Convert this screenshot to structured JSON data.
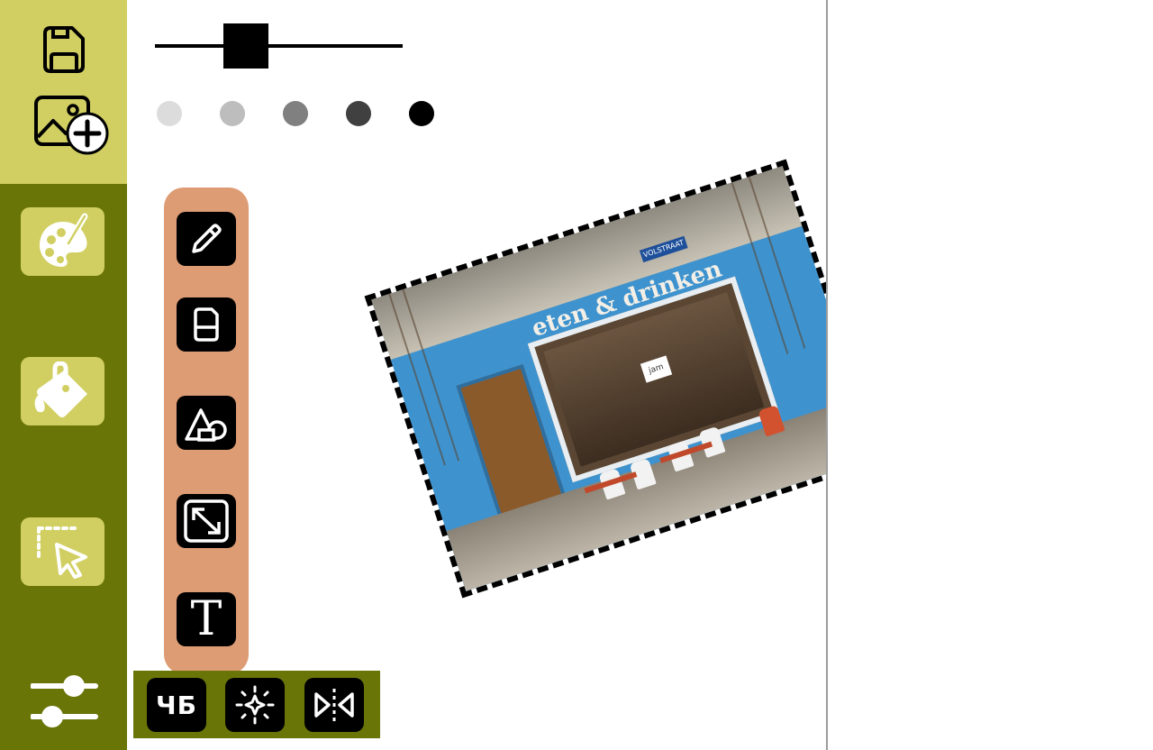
{
  "sidebar": {
    "top_buttons": [
      {
        "name": "save",
        "icon": "save-icon"
      },
      {
        "name": "add-image",
        "icon": "add-image-icon"
      }
    ],
    "main_buttons": [
      {
        "name": "palette",
        "icon": "palette-icon"
      },
      {
        "name": "fill",
        "icon": "paint-bucket-icon"
      },
      {
        "name": "select",
        "icon": "selection-pointer-icon"
      }
    ],
    "bottom_icon": "sliders-icon"
  },
  "brush": {
    "size_level": 0.36,
    "colors": [
      "#dcdcdc",
      "#bdbdbd",
      "#808080",
      "#404040",
      "#000000"
    ]
  },
  "tools": [
    {
      "name": "pencil",
      "icon": "pencil-icon"
    },
    {
      "name": "eraser",
      "icon": "eraser-icon"
    },
    {
      "name": "shapes",
      "icon": "shapes-icon"
    },
    {
      "name": "resize",
      "icon": "resize-icon"
    },
    {
      "name": "text",
      "icon": "text-icon",
      "glyph": "T"
    }
  ],
  "filters": {
    "bw_label": "ЧБ",
    "items": [
      {
        "name": "black-white",
        "icon": "bw-filter-icon"
      },
      {
        "name": "brightness",
        "icon": "brightness-sparkle-icon"
      },
      {
        "name": "mirror",
        "icon": "mirror-flip-icon"
      }
    ]
  },
  "photo": {
    "sign_text": "eten & drinken",
    "street_plate": "VOLSTRAAT",
    "window_logo": "jam"
  },
  "colors": {
    "sidebar_light": "#d1cf62",
    "sidebar_dark": "#6a7508",
    "tool_palette": "#de9c75",
    "icon_dark": "#000000"
  }
}
